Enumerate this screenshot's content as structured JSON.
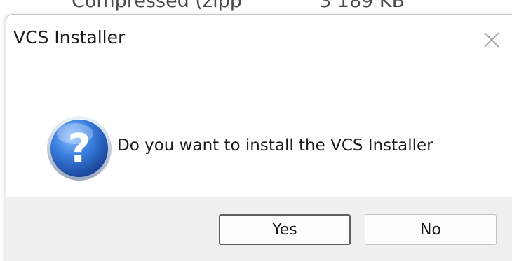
{
  "background": {
    "row_name": "Compressed (zipp",
    "row_size": "3 189 KB"
  },
  "dialog": {
    "title": "VCS Installer",
    "message": "Do you want to install the VCS Installer",
    "buttons": {
      "yes_label": "Yes",
      "no_label": "No"
    },
    "icons": {
      "main": "question-icon",
      "close": "close-icon"
    }
  },
  "colors": {
    "footer_bg": "#f0f0f0",
    "icon_blue": "#2a66c9",
    "text": "#1b1b1b"
  }
}
